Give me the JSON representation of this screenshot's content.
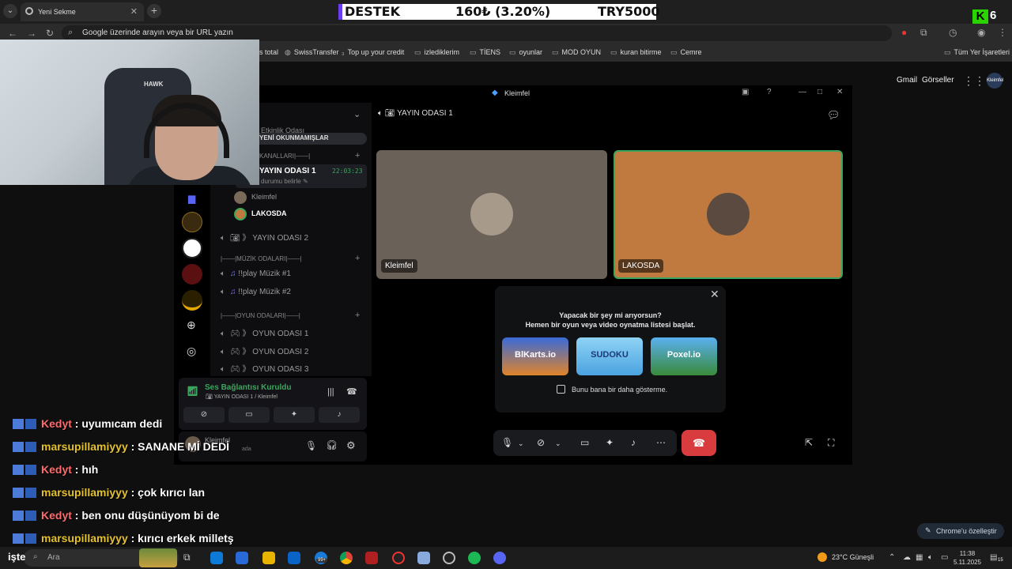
{
  "browser": {
    "tab_title": "Yeni Sekme",
    "omnibox_placeholder": "Google üzerinde arayın veya bir URL yazın",
    "bookmarks": [
      "s total",
      "SwissTransfer",
      "Top up your credit",
      "izlediklerim",
      "TİENS",
      "oyunlar",
      "MOD OYUN",
      "kuran bitirme",
      "Cemre"
    ],
    "all_bookmarks": "Tüm Yer İşaretleri",
    "gmail": "Gmail",
    "images": "Görseller",
    "profile": "Kleimfel",
    "customize": "Chrome'u özelleştir"
  },
  "overlay": {
    "label": "DESTEK",
    "amount": "160₺ (3.20%)",
    "goal": "TRY5000"
  },
  "kick": {
    "letter": "K",
    "count": "6"
  },
  "webcam": {
    "chair_logo": "HAWK"
  },
  "discord": {
    "window_title": "Kleimfel",
    "server_header": "Sohbetler",
    "partial_name": "Etkinlik Odası",
    "unread_pill": "YENİ OKUNMAMIŞLAR",
    "category_1": "KANALLARI|——|",
    "active_channel": "YAYIN ODASI 1",
    "active_time": "22:03:23",
    "status_hint": "durumu belirle",
    "members": [
      "Kleimfel",
      "LAKOSDA"
    ],
    "channel_2": "YAYIN ODASI 2",
    "music_category": "|——|MÜZİK ODALARI|——|",
    "music_channels": [
      "!!play Müzik #1",
      "!!play Müzik #2"
    ],
    "game_category": "|——|OYUN ODALARI|——|",
    "game_channels": [
      "OYUN ODASI 1",
      "OYUN ODASI 2",
      "OYUN ODASI 3"
    ],
    "voice_status": "Ses Bağlantısı Kuruldu",
    "voice_sub": "YAYIN ODASI 1 / Kleimfel",
    "user_name": "Kleimfel",
    "user_status": "ada",
    "stage_header": "YAYIN ODASI 1",
    "tile_1": "Kleimfel",
    "tile_2": "LAKOSDA",
    "activity_line1": "Yapacak bir şey mi arıyorsun?",
    "activity_line2": "Hemen bir oyun veya video oynatma listesi başlat.",
    "games": [
      "BlKarts.io",
      "SUDOKU",
      "Poxel.io"
    ],
    "dont_show": "Bunu bana bir daha gösterme."
  },
  "chat": [
    {
      "user": "Kedyt",
      "msg": ": uyumıcam dedi",
      "color": "red"
    },
    {
      "user": "marsupillamiyyy",
      "msg": ": SANANE Mİ DEDİ",
      "color": "yellow"
    },
    {
      "user": "Kedyt",
      "msg": ": hıh",
      "color": "red"
    },
    {
      "user": "marsupillamiyyy",
      "msg": ": çok kırıcı lan",
      "color": "yellow"
    },
    {
      "user": "Kedyt",
      "msg": ": ben onu düşünüyom bi de",
      "color": "red"
    },
    {
      "user": "marsupillamiyyy",
      "msg": ": kırıcı erkek milletş",
      "color": "yellow"
    }
  ],
  "taskbar": {
    "start_text": "işte",
    "search_text": "Ara",
    "badge": "99+",
    "weather": "23°C Güneşli",
    "time": "11:38",
    "date": "5.11.2025",
    "notif": "15"
  }
}
